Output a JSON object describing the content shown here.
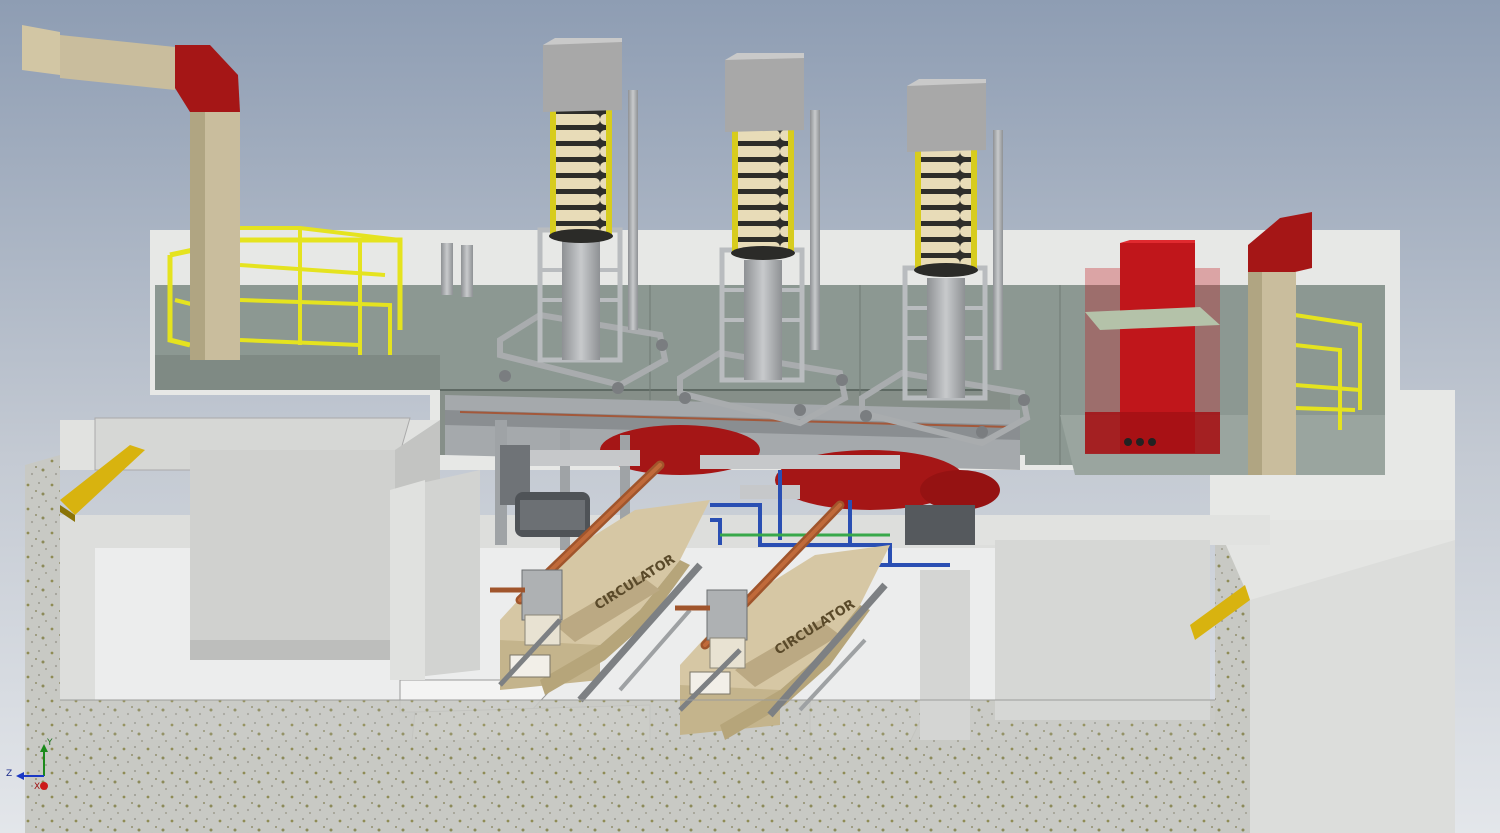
{
  "viewport": {
    "background_top": "#8e9db3",
    "background_bottom": "#e3e6ea"
  },
  "modulators": {
    "count": 3,
    "cabinet_color": "#a8a8a8",
    "coil_color": "#e8dcb8",
    "coil_accent": "#d7cc1e",
    "frame_color": "#b9bcbf"
  },
  "circulators": {
    "count": 2,
    "body_color": "#d6c7a4",
    "label": "CIRCULATOR"
  },
  "waveguide": {
    "duct_color": "#c9bd9d",
    "bend_color": "#a51616"
  },
  "railings": {
    "color": "#e5e31f"
  },
  "rack": {
    "color": "#c0161b"
  },
  "floor": {
    "deck_color": "#8c9892",
    "concrete_color": "#c8c9c4"
  },
  "view_triad": {
    "axis_y": "Y",
    "axis_z": "Z",
    "axis_x": "X"
  }
}
